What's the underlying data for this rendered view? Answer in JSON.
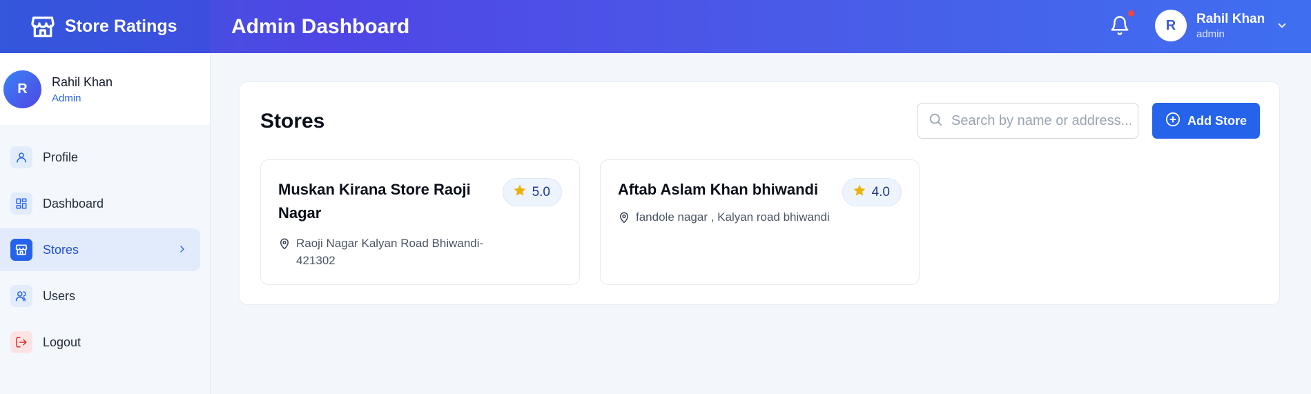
{
  "header": {
    "brand_title": "Store Ratings",
    "page_title": "Admin Dashboard",
    "user": {
      "initial": "R",
      "name": "Rahil Khan",
      "role": "admin"
    }
  },
  "sidebar": {
    "profile": {
      "initial": "R",
      "name": "Rahil Khan",
      "role": "Admin"
    },
    "items": [
      {
        "label": "Profile",
        "icon": "user-icon"
      },
      {
        "label": "Dashboard",
        "icon": "grid-icon"
      },
      {
        "label": "Stores",
        "icon": "store-icon",
        "active": true
      },
      {
        "label": "Users",
        "icon": "users-icon"
      },
      {
        "label": "Logout",
        "icon": "logout-icon"
      }
    ]
  },
  "main": {
    "title": "Stores",
    "search_placeholder": "Search by name or address...",
    "add_button_label": "Add Store",
    "stores": [
      {
        "name": "Muskan Kirana Store Raoji Nagar",
        "rating": "5.0",
        "address": "Raoji Nagar Kalyan Road Bhiwandi-421302"
      },
      {
        "name": "Aftab Aslam Khan bhiwandi",
        "rating": "4.0",
        "address": "fandole nagar , Kalyan road bhiwandi"
      }
    ]
  },
  "colors": {
    "primary": "#2563eb",
    "header_gradient_start": "#3b5bdb",
    "header_gradient_mid": "#4f46e5",
    "star": "#eab308",
    "notification_dot": "#ef4444",
    "logout_icon": "#dc2626"
  }
}
